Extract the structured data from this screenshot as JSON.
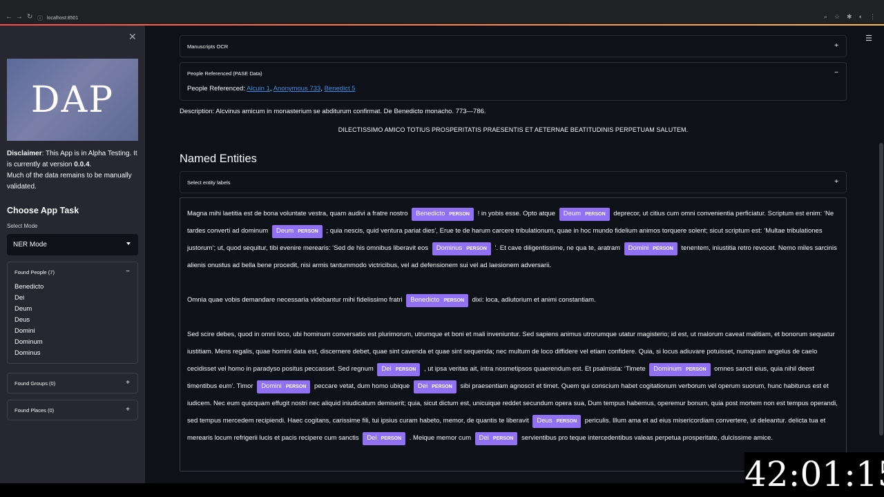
{
  "browser": {
    "url": "localhost:8501"
  },
  "sidebar": {
    "logo_text": "DAP",
    "disclaimer_bold": "Disclaimer",
    "disclaimer_1": ": This App is in Alpha Testing. It is currently at version ",
    "version": "0.0.4",
    "disclaimer_2": ".",
    "disclaimer_3": "Much of the data remains to be manually validated.",
    "choose_title": "Choose App Task",
    "select_label": "Select Mode",
    "select_value": "NER Mode",
    "found_people": {
      "label": "Found People (7)",
      "items": [
        "Benedicto",
        "Dei",
        "Deum",
        "Deus",
        "Domini",
        "Dominum",
        "Dominus"
      ]
    },
    "found_groups": {
      "label": "Found Groups (0)"
    },
    "found_places": {
      "label": "Found Places (0)"
    }
  },
  "main": {
    "manuscripts": {
      "label": "Manuscripts OCR"
    },
    "people_ref": {
      "label": "People Referenced (PASE Data)",
      "prefix": "People Referenced: ",
      "links": [
        "Alcuin 1",
        "Anonymous 733",
        "Benedict 5"
      ]
    },
    "description": "Description: Alcvinus amicum in monasterium se abditurum confirmat. De Benedicto monacho. 773—786.",
    "greeting": "DILECTISSIMO AMICO TOTIUS PROSPERITATIS PRAESENTIS ET AETERNAE BEATITUDINIS PERPETUAM SALUTEM.",
    "ne_title": "Named Entities",
    "select_labels": "Select entity labels",
    "entity_label": "PERSON",
    "paragraphs": [
      [
        "Magna mihi laetitia est de bona voluntate vestra, quam audivi a fratre nostro ",
        {
          "e": "Benedicto"
        },
        " ! in yobis esse. Opto atque ",
        {
          "e": "Deum"
        },
        " deprecor, ut citius cum omni convenientia perficiatur. Scriptum est enim: ‘Ne tardes converti ad dominum ",
        {
          "e": "Deum"
        },
        " ; quia nescis, quid ventura pariat dies’, Erue te de harum carcere tribulationum, quae in hoc mundo fidelium animos torquere solent; sicut scriptum est: ‘Multae tribulationes justorum’; ut, quod sequitur, tibi evenire merearis: ‘Sed de his omnibus liberavit eos ",
        {
          "e": "Dominus"
        },
        " ’. Et cave diligentissime, ne qua te, aratram ",
        {
          "e": "Domini"
        },
        " tenentem, iniustitia retro revocet. Nemo miles sarcinis alienis onustus ad bella bene procedit, nisi armis tantummodo victricibus, vel ad defensionem sui vel ad laesionem adversarii."
      ],
      [
        "Omnia quae vobis demandare necessaria videbantur mihi fidelissimo fratri ",
        {
          "e": "Benedicto"
        },
        " dixi: loca, adiutorium et animi constantiam."
      ],
      [
        "Sed scire debes, quod in omni loco, ubi hominum conversatio est plurimorum, utrumque et boni et mali inveniuntur. Sed sapiens animus utrorumque utatur magisterio; id est, ut malorum caveat malitiam, et bonorum sequatur iustitiam. Mens regalis, quae homini data est, discernere debet, quae sint cavenda et quae sint sequenda; nec multum de loco diffidere vel etiam confidere. Quia, si locus adiuvare potuisset, numquam angelus de caelo cecidisset vel homo in paradyso positus peccasset. Sed regnum ",
        {
          "e": "Dei"
        },
        " , ut ipsa veritas ait, intra nosmetipsos quaerendum est. Et psalmista: ‘Timete ",
        {
          "e": "Dominum"
        },
        " omnes sancti eius, quia nihil deest timentibus eum’. Timor ",
        {
          "e": "Domini"
        },
        " peccare vetat, dum homo ubique ",
        {
          "e": "Dei"
        },
        " sibi praesentiam agnoscit et timet. Quem qui conscium habet cogitationum verborum vel operum suorum, hunc habiturus est et iudicem. Nec eum quicquam effugit nostri nec aliquid iniudicatum demiserit; quia, sicut dictum est, unicuique reddet secundum opera sua, Dum tempus habemus, operemur bonum, quia post mortem non est tempus operandi, sed tempus mercedem recipiendi. Haec cogitans, carissime fili, tui ipsius curam habeto, memor, de quantis te liberavit ",
        {
          "e": "Deus"
        },
        " periculis. Illum ama et ad eius misericordiam convertere, ut deleantur. delicta tua et merearis locum refrigerii lucis et pacis recipere cum sanctis ",
        {
          "e": "Dei"
        },
        " . Meique memor cum ",
        {
          "e": "Dei"
        },
        " servientibus pro teque intercedentibus valeas perpetua prosperitate, dulcissime amice."
      ]
    ]
  },
  "overlay": {
    "clock": "42:01:15"
  }
}
